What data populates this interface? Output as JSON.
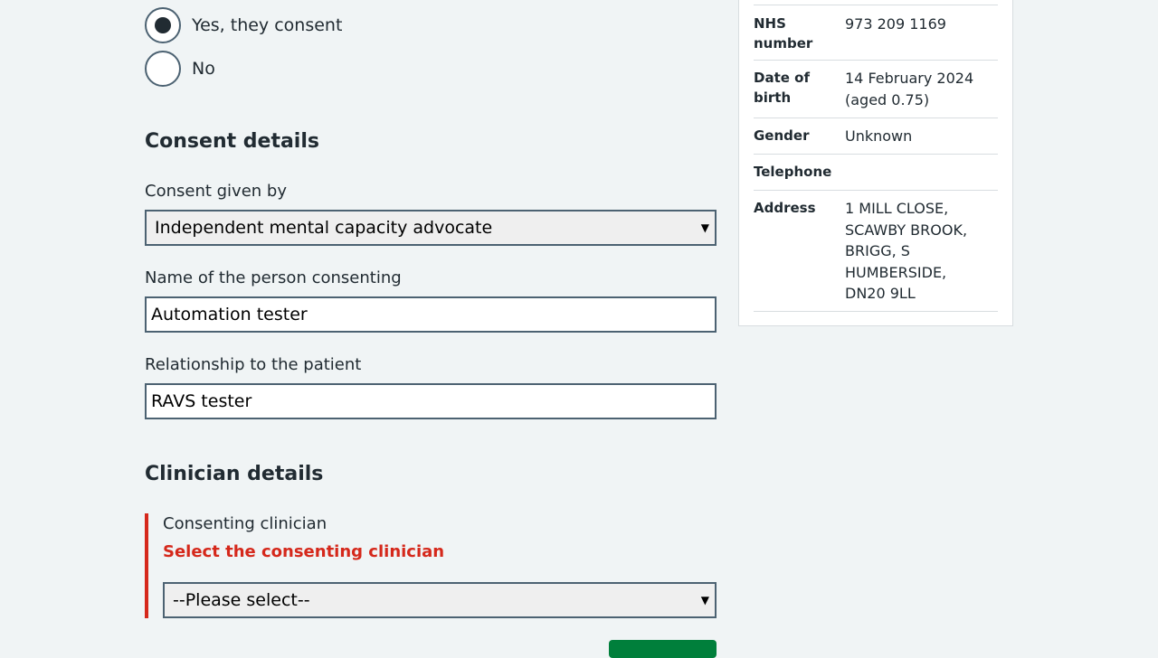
{
  "consent_question": {
    "options": [
      {
        "label": "Yes, they consent",
        "checked": true
      },
      {
        "label": "No",
        "checked": false
      }
    ]
  },
  "consent_details": {
    "heading": "Consent details",
    "given_by_label": "Consent given by",
    "given_by_value": "Independent mental capacity advocate",
    "name_label": "Name of the person consenting",
    "name_value": "Automation tester",
    "relationship_label": "Relationship to the patient",
    "relationship_value": "RAVS tester"
  },
  "clinician_details": {
    "heading": "Clinician details",
    "clinician_label": "Consenting clinician",
    "error_message": "Select the consenting clinician",
    "clinician_value": "--Please select--"
  },
  "patient_summary": {
    "nhs_number_key": "NHS number",
    "nhs_number_value": "973 209 1169",
    "dob_key": "Date of birth",
    "dob_value": "14 February 2024 (aged 0.75)",
    "gender_key": "Gender",
    "gender_value": "Unknown",
    "telephone_key": "Telephone",
    "telephone_value": "",
    "address_key": "Address",
    "address_value": "1 MILL CLOSE, SCAWBY BROOK, BRIGG, S HUMBERSIDE, DN20 9LL"
  },
  "colors": {
    "background": "#f0f4f5",
    "text": "#212b32",
    "input_border": "#4c6272",
    "error": "#d5281b",
    "button": "#007f3b"
  }
}
